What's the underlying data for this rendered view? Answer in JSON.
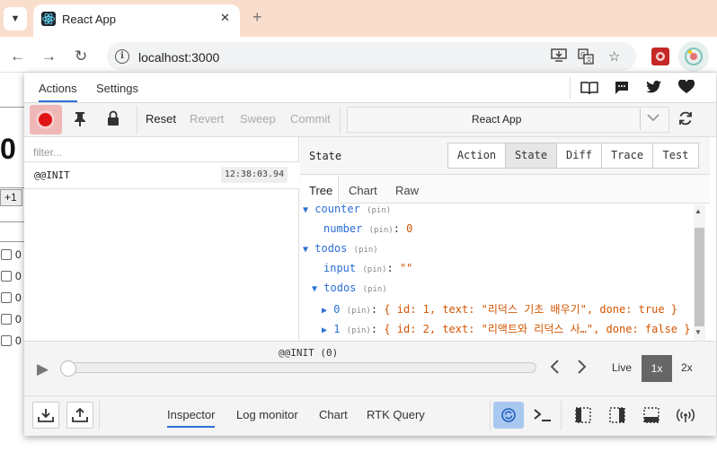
{
  "browser": {
    "tab_title": "React App",
    "tab_close": "✕",
    "new_tab": "+",
    "url": "localhost:3000"
  },
  "page_behind": {
    "counter_value": "0",
    "plus_button": "+1",
    "todo_stub": "0"
  },
  "devtools": {
    "header_tabs": [
      "Actions",
      "Settings"
    ],
    "toolbar": {
      "buttons": [
        "Reset",
        "Revert",
        "Sweep",
        "Commit"
      ],
      "instance": "React App"
    },
    "filter_placeholder": "filter...",
    "actions": [
      {
        "name": "@@INIT",
        "time": "12:38:03.94"
      }
    ],
    "right_title": "State",
    "monitor_tabs": [
      "Action",
      "State",
      "Diff",
      "Trace",
      "Test"
    ],
    "sub_tabs": [
      "Tree",
      "Chart",
      "Raw"
    ],
    "tree": {
      "pin": "(pin)",
      "counter_key": "counter",
      "number_key": "number",
      "number_value": "0",
      "todos_key": "todos",
      "input_key": "input",
      "input_value": "\"\"",
      "todos_inner_key": "todos",
      "item0_index": "0",
      "item0_summary": "{ id: 1, text: \"리덕스 기초 배우기\", done: true }",
      "item1_index": "1",
      "item1_summary": "{ id: 2, text: \"리액트와 리덕스 사…\", done: false }"
    },
    "slider": {
      "label": "@@INIT (0)",
      "speeds": [
        "Live",
        "1x",
        "2x"
      ]
    },
    "footer_tabs": [
      "Inspector",
      "Log monitor",
      "Chart",
      "RTK Query"
    ]
  }
}
